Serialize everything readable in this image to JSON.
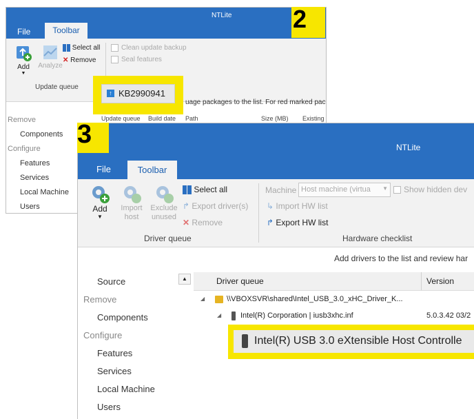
{
  "win2": {
    "badge": "2",
    "title": "NTLite",
    "tabs": [
      {
        "label": "File"
      },
      {
        "label": "Toolbar"
      }
    ],
    "ribbon": {
      "add": "Add",
      "analyze": "Analyze",
      "select_all": "Select all",
      "remove": "Remove",
      "clean_update_backup": "Clean update backup",
      "seal_features": "Seal features",
      "group_label": "Update queue"
    },
    "kb_label": "KB2990941",
    "hint": "uage packages to the list. For red marked pac",
    "columns": [
      "Update queue",
      "Build date",
      "Path",
      "Size (MB)",
      "Existing"
    ],
    "sidebar": [
      "Remove",
      "Components",
      "Configure",
      "Features",
      "Services",
      "Local Machine",
      "Users"
    ]
  },
  "win3": {
    "badge": "3",
    "title": "NTLite",
    "tabs": [
      {
        "label": "File"
      },
      {
        "label": "Toolbar"
      }
    ],
    "ribbon": {
      "add": "Add",
      "import_host": "Import host",
      "exclude_unused": "Exclude unused",
      "select_all": "Select all",
      "export_drivers": "Export driver(s)",
      "remove": "Remove",
      "group_driver_queue": "Driver queue",
      "machine_label": "Machine",
      "machine_value": "Host machine (virtua",
      "show_hidden": "Show hidden dev",
      "import_hw": "Import HW list",
      "export_hw": "Export HW list",
      "group_hw_checklist": "Hardware checklist"
    },
    "hint": "Add drivers to the list and review har",
    "sidebar": [
      "Source",
      "Remove",
      "Components",
      "Configure",
      "Features",
      "Services",
      "Local Machine",
      "Users"
    ],
    "columns": [
      "Driver queue",
      "Version"
    ],
    "tree": {
      "folder_path": "\\\\VBOXSVR\\shared\\Intel_USB_3.0_xHC_Driver_K...",
      "vendor": "Intel(R) Corporation  |  iusb3xhc.inf",
      "version": "5.0.3.42  03/2",
      "device": "Intel(R) USB 3.0 eXtensible Host Controlle"
    }
  },
  "colors": {
    "accent": "#2a6fc1",
    "highlight": "#f7e600"
  }
}
